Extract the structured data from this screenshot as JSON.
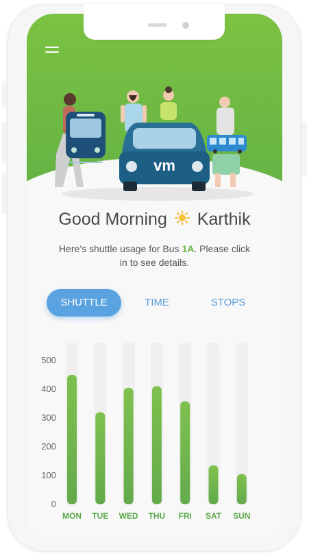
{
  "header": {
    "menu_icon": "hamburger-menu-icon",
    "brand_logo_text": "vm"
  },
  "greeting": {
    "prefix": "Good Morning",
    "icon": "sun-icon",
    "name": "Karthik"
  },
  "subtitle": {
    "before": "Here’s shuttle usage for Bus ",
    "bus": "1A",
    "after": ". Please click in to see details."
  },
  "tabs": [
    {
      "label": "SHUTTLE",
      "active": true
    },
    {
      "label": "TIME",
      "active": false
    },
    {
      "label": "STOPS",
      "active": false
    }
  ],
  "colors": {
    "brand_green": "#6bb443",
    "accent_blue": "#5aa2e0",
    "bar_green": "#78bb4c",
    "bus_blue": "#1e5f82"
  },
  "chart_data": {
    "type": "bar",
    "categories": [
      "MON",
      "TUE",
      "WED",
      "THU",
      "FRI",
      "SAT",
      "SUN"
    ],
    "values": [
      450,
      320,
      405,
      410,
      358,
      135,
      105
    ],
    "ylim": [
      0,
      500
    ],
    "yticks": [
      0,
      100,
      200,
      300,
      400,
      500
    ],
    "grid": false,
    "title": "",
    "xlabel": "",
    "ylabel": ""
  }
}
